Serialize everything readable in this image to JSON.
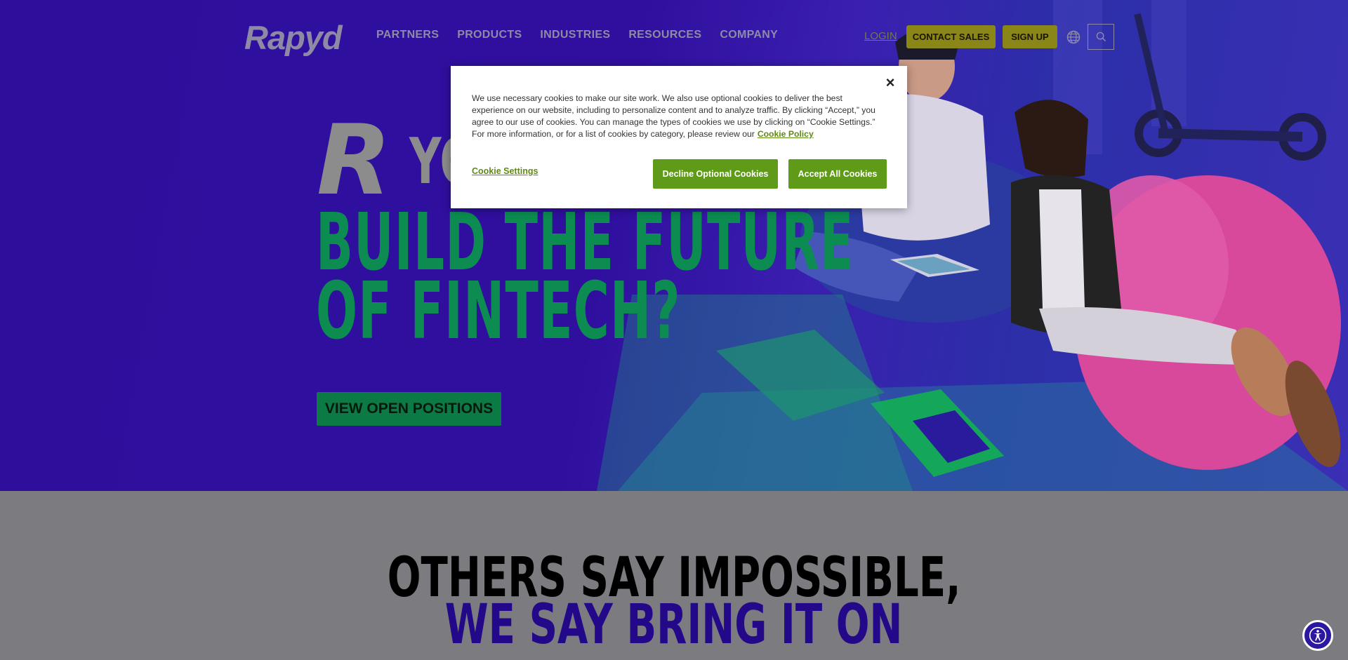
{
  "brand": {
    "logo_text": "Rapyd"
  },
  "nav": {
    "links": [
      "PARTNERS",
      "PRODUCTS",
      "INDUSTRIES",
      "RESOURCES",
      "COMPANY"
    ],
    "login": "LOGIN",
    "contact_sales": "CONTACT SALES",
    "sign_up": "SIGN UP",
    "globe_icon": "globe-icon",
    "search_icon": "search-icon"
  },
  "hero": {
    "partial_r": "R",
    "partial_you": "YO",
    "line1": "BUILD THE FUTURE",
    "line2": "OF FINTECH?",
    "cta": "VIEW OPEN POSITIONS"
  },
  "section": {
    "line1": "OTHERS SAY IMPOSSIBLE,",
    "line2": "WE SAY BRING IT ON"
  },
  "cookie": {
    "close_label": "×",
    "text": "We use necessary cookies to make our site work. We also use optional cookies to deliver the best experience on our website, including to personalize content and to analyze traffic. By clicking “Accept,” you agree to our use of cookies. You can manage the types of cookies we use by clicking on “Cookie Settings.” For more information, or for a list of cookies by category, please review our",
    "policy_link": "Cookie Policy",
    "settings": "Cookie Settings",
    "decline": "Decline Optional Cookies",
    "accept": "Accept All Cookies"
  },
  "colors": {
    "hero_bg": "#2e0f9c",
    "accent_green": "#0c8c50",
    "cookie_green": "#5f9a18",
    "nav_yellow": "#8a8618",
    "bring_purple": "#23098a"
  }
}
